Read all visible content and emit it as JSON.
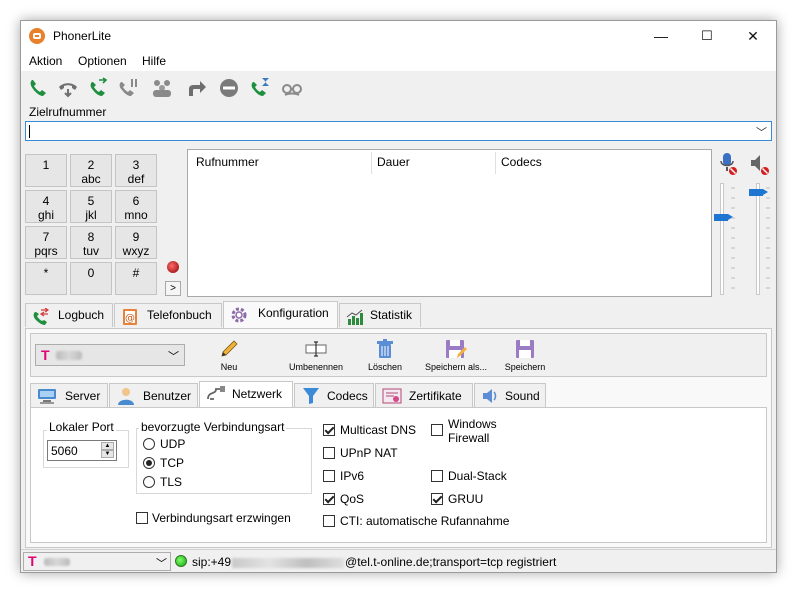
{
  "window": {
    "title": "PhonerLite",
    "minimize": "—",
    "maximize": "☐",
    "close": "✕"
  },
  "menu": {
    "items": [
      "Aktion",
      "Optionen",
      "Hilfe"
    ]
  },
  "toolbar": {
    "icons": [
      "call-icon",
      "hangup-icon",
      "accept-call-icon",
      "hold-icon",
      "conference-icon",
      "forward-icon",
      "dnd-icon",
      "callback-icon",
      "anonymous-icon"
    ]
  },
  "dial": {
    "label": "Zielrufnummer",
    "value": ""
  },
  "keypad": {
    "keys": [
      {
        "digit": "1",
        "letters": ""
      },
      {
        "digit": "2",
        "letters": "abc"
      },
      {
        "digit": "3",
        "letters": "def"
      },
      {
        "digit": "4",
        "letters": "ghi"
      },
      {
        "digit": "5",
        "letters": "jkl"
      },
      {
        "digit": "6",
        "letters": "mno"
      },
      {
        "digit": "7",
        "letters": "pqrs"
      },
      {
        "digit": "8",
        "letters": "tuv"
      },
      {
        "digit": "9",
        "letters": "wxyz"
      },
      {
        "digit": "*",
        "letters": ""
      },
      {
        "digit": "0",
        "letters": ""
      },
      {
        "digit": "#",
        "letters": ""
      }
    ],
    "more": ">"
  },
  "calllist": {
    "columns": [
      "Rufnummer",
      "Dauer",
      "Codecs"
    ]
  },
  "volume": {
    "mic_level": 0.18,
    "speaker_level": 0.0
  },
  "main_tabs": {
    "items": [
      "Logbuch",
      "Telefonbuch",
      "Konfiguration",
      "Statistik"
    ],
    "active": "Konfiguration"
  },
  "config_toolbar": {
    "account_logo": "T",
    "buttons": [
      "Neu",
      "Umbenennen",
      "Löschen",
      "Speichern als...",
      "Speichern"
    ]
  },
  "sub_tabs": {
    "items": [
      "Server",
      "Benutzer",
      "Netzwerk",
      "Codecs",
      "Zertifikate",
      "Sound"
    ],
    "active": "Netzwerk"
  },
  "network": {
    "local_port_label": "Lokaler Port",
    "local_port_value": "5060",
    "conn_group_label": "bevorzugte Verbindungsart",
    "conn_options": [
      "UDP",
      "TCP",
      "TLS"
    ],
    "conn_selected": "TCP",
    "force_conn": {
      "label": "Verbindungsart erzwingen",
      "checked": false
    },
    "checks": {
      "multicast_dns": {
        "label": "Multicast DNS",
        "checked": true
      },
      "upnp_nat": {
        "label": "UPnP NAT",
        "checked": false
      },
      "ipv6": {
        "label": "IPv6",
        "checked": false
      },
      "qos": {
        "label": "QoS",
        "checked": true
      },
      "cti": {
        "label": "CTI: automatische Rufannahme",
        "checked": false
      },
      "windows_firewall": {
        "label": "Windows Firewall",
        "checked": false
      },
      "dual_stack": {
        "label": "Dual-Stack",
        "checked": false
      },
      "gruu": {
        "label": "GRUU",
        "checked": true
      }
    }
  },
  "status": {
    "account_logo": "T",
    "prefix": "sip:+49",
    "suffix": "@tel.t-online.de;transport=tcp registriert",
    "led_color": "#22c41a"
  }
}
